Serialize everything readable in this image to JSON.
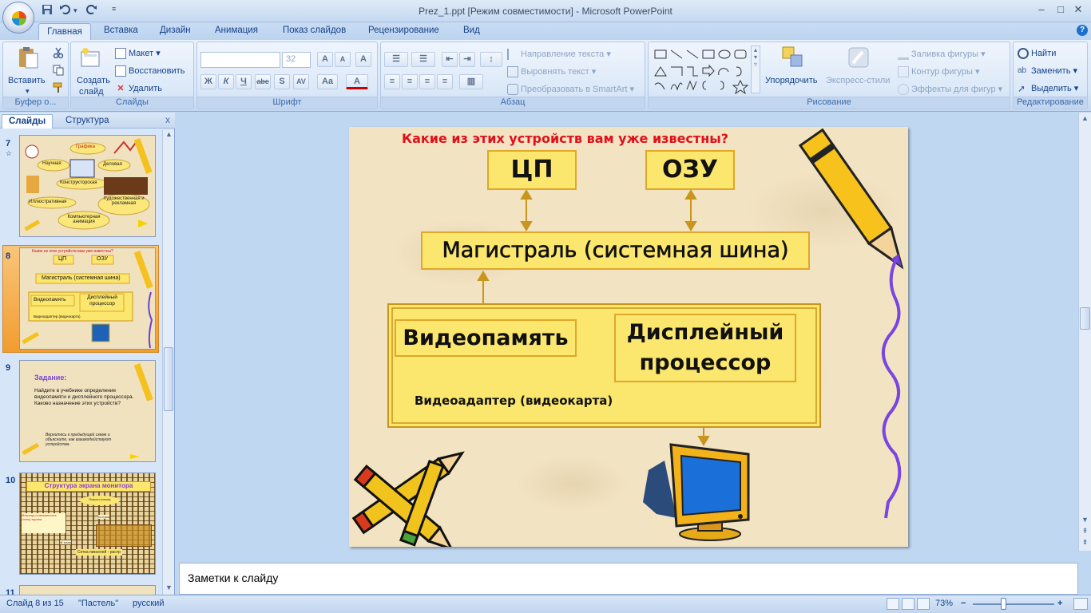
{
  "window": {
    "title": "Prez_1.ppt [Режим совместимости] - Microsoft PowerPoint",
    "minimize": "–",
    "maximize": "□",
    "close": "✕"
  },
  "quick_access": {
    "save_icon": "save-icon",
    "undo_icon": "undo-icon",
    "redo_icon": "redo-icon",
    "customize_icon": "customize-icon"
  },
  "tabs": [
    "Главная",
    "Вставка",
    "Дизайн",
    "Анимация",
    "Показ слайдов",
    "Рецензирование",
    "Вид"
  ],
  "ribbon": {
    "clipboard": {
      "label": "Буфер о...",
      "paste": "Вставить",
      "paste_arrow": "▾"
    },
    "slides": {
      "label": "Слайды",
      "create": "Создать",
      "create2": "слайд",
      "layout": "Макет",
      "reset": "Восстановить",
      "delete": "Удалить"
    },
    "font": {
      "label": "Шрифт",
      "font_value": "",
      "size_value": "32",
      "bold": "Ж",
      "italic": "К",
      "underline": "Ч",
      "strike": "abe",
      "shadow": "S",
      "spacing": "AV",
      "case": "Aa",
      "grow": "A",
      "shrink": "A",
      "clear": "A",
      "color": "A"
    },
    "paragraph": {
      "label": "Абзац",
      "text_direction": "Направление текста",
      "align_text": "Выровнять текст",
      "smartart": "Преобразовать в SmartArt"
    },
    "drawing": {
      "label": "Рисование",
      "arrange": "Упорядочить",
      "styles": "Экспресс-стили",
      "fill": "Заливка фигуры",
      "outline": "Контур фигуры",
      "effects": "Эффекты для фигур"
    },
    "editing": {
      "label": "Редактирование",
      "find": "Найти",
      "replace": "Заменить",
      "select": "Выделить"
    }
  },
  "panel": {
    "tab_slides": "Слайды",
    "tab_outline": "Структура",
    "close": "x",
    "thumbnails": [
      {
        "num": "7",
        "star": "☆"
      },
      {
        "num": "8"
      },
      {
        "num": "9"
      },
      {
        "num": "10"
      },
      {
        "num": "11"
      }
    ],
    "thumb7": {
      "grafika": "Графика",
      "nauch": "Научная",
      "delov": "Деловая",
      "konstr": "Конструкторская",
      "illustr": "Иллюстративная",
      "hud": "Художественная и рекламная",
      "komp": "Компьютерная анимация"
    },
    "thumb8": {
      "q": "Какие из этих устройств вам уже известны?",
      "cpu": "ЦП",
      "ram": "ОЗУ",
      "bus": "Магистраль (системная шина)",
      "vram": "Видеопамять",
      "dp": "Дисплейный процессор",
      "va": "Видеоадаптер (видеокарта)"
    },
    "thumb9": {
      "title": "Задание:",
      "body": "Найдите в учебнике определение видеопамяти и дисплейного процессора. Каково назначение этих устройств?",
      "note": "Вернитесь к предыдущей схеме и объясните, как взаимодействуют устройства."
    },
    "thumb10": {
      "title": "Структура экрана монитора",
      "t1": "Пиксел (точка)",
      "t2": "Матрица (совокупность точек) экрана",
      "t3": "Сетка пикселей - растр",
      "t4": "N строк",
      "t5": "М точек"
    }
  },
  "slide": {
    "question": "Какие из этих устройств вам уже известны?",
    "cpu": "ЦП",
    "ram": "ОЗУ",
    "bus": "Магистраль (системная шина)",
    "vram": "Видеопамять",
    "dp_line1": "Дисплейный",
    "dp_line2": "процессор",
    "adapter": "Видеоадаптер (видеокарта)"
  },
  "notes": {
    "placeholder": "Заметки к слайду"
  },
  "status": {
    "slide": "Слайд 8 из 15",
    "theme": "\"Пастель\"",
    "lang": "русский",
    "zoom": "73%",
    "zoom_minus": "−",
    "zoom_plus": "+"
  },
  "colors": {
    "accent": "#15428b",
    "box_fill": "#fbe66e",
    "box_border": "#e0a728",
    "question": "#e0101a",
    "selected_thumb": "#f39c2f"
  }
}
